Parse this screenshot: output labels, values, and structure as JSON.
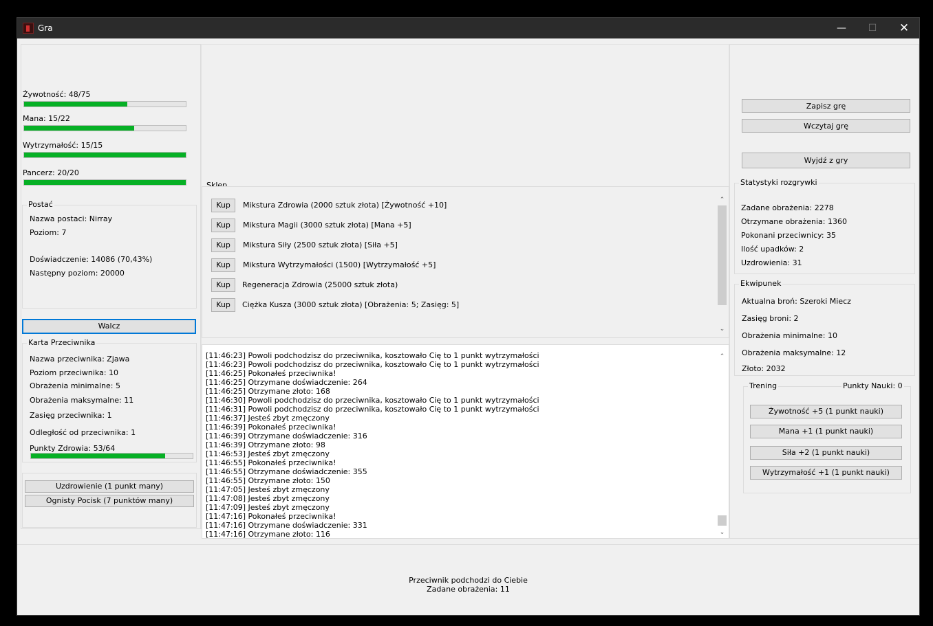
{
  "window": {
    "title": "Gra",
    "min": "—",
    "max": "☐",
    "close": "✕"
  },
  "stats": [
    {
      "label": "Żywotność: 48/75",
      "value": 48,
      "max": 75
    },
    {
      "label": "Mana: 15/22",
      "value": 15,
      "max": 22
    },
    {
      "label": "Wytrzymałość: 15/15",
      "value": 15,
      "max": 15
    },
    {
      "label": "Pancerz: 20/20",
      "value": 20,
      "max": 20
    }
  ],
  "postac": {
    "title": "Postać",
    "name": "Nazwa postaci: Nirray",
    "level": "Poziom: 7",
    "exp": "Doświadczenie: 14086 (70,43%)",
    "next": "Następny poziom: 20000"
  },
  "fight_button": "Walcz",
  "enemy": {
    "title": "Karta Przeciwnika",
    "name": "Nazwa przeciwnika: Zjawa",
    "level": "Poziom przeciwnika: 10",
    "dmg_min": "Obrażenia minimalne: 5",
    "dmg_max": "Obrażenia maksymalne: 11",
    "range": "Zasięg przeciwnika: 1",
    "distance": "Odległość od przeciwnika: 1",
    "hp_label": "Punkty Zdrowia: 53/64",
    "hp": 53,
    "hp_max": 64
  },
  "spells": [
    "Uzdrowienie (1 punkt many)",
    "Ognisty Pocisk (7 punktów many)"
  ],
  "shop": {
    "title": "Sklep",
    "buy_label": "Kup",
    "items": [
      "Mikstura Zdrowia (2000 sztuk złota) [Żywotność +10]",
      "Mikstura Magii (3000 sztuk złota) [Mana +5]",
      "Mikstura Siły (2500 sztuk złota) [Siła +5]",
      "Mikstura Wytrzymałości (1500) [Wytrzymałość +5]",
      "Regeneracja Zdrowia (25000 sztuk złota)",
      "Ciężka Kusza (3000 sztuk złota)  [Obrażenia: 5; Zasięg: 5]"
    ]
  },
  "log": [
    "[11:46:23] Powoli podchodzisz do przeciwnika, kosztowało Cię to 1 punkt wytrzymałości",
    "[11:46:23] Powoli podchodzisz do przeciwnika, kosztowało Cię to 1 punkt wytrzymałości",
    "[11:46:25] Pokonałeś przeciwnika!",
    "[11:46:25] Otrzymane doświadczenie: 264",
    "[11:46:25] Otrzymane złoto: 168",
    "[11:46:30] Powoli podchodzisz do przeciwnika, kosztowało Cię to 1 punkt wytrzymałości",
    "[11:46:31] Powoli podchodzisz do przeciwnika, kosztowało Cię to 1 punkt wytrzymałości",
    "[11:46:37] Jesteś zbyt zmęczony",
    "[11:46:39] Pokonałeś przeciwnika!",
    "[11:46:39] Otrzymane doświadczenie: 316",
    "[11:46:39] Otrzymane złoto: 98",
    "[11:46:53] Jesteś zbyt zmęczony",
    "[11:46:55] Pokonałeś przeciwnika!",
    "[11:46:55] Otrzymane doświadczenie: 355",
    "[11:46:55] Otrzymane złoto: 150",
    "[11:47:05] Jesteś zbyt zmęczony",
    "[11:47:08] Jesteś zbyt zmęczony",
    "[11:47:09] Jesteś zbyt zmęczony",
    "[11:47:16] Pokonałeś przeciwnika!",
    "[11:47:16] Otrzymane doświadczenie: 331",
    "[11:47:16] Otrzymane złoto: 116"
  ],
  "menu": {
    "save": "Zapisz grę",
    "load": "Wczytaj grę",
    "exit": "Wyjdź z gry"
  },
  "game_stats": {
    "title": "Statystyki rozgrywki",
    "dealt": "Zadane obrażenia: 2278",
    "received": "Otrzymane obrażenia: 1360",
    "defeated": "Pokonani przeciwnicy: 35",
    "falls": "Ilość upadków: 2",
    "heals": "Uzdrowienia: 31"
  },
  "equipment": {
    "title": "Ekwipunek",
    "weapon": "Aktualna broń: Szeroki Miecz",
    "range": "Zasięg broni: 2",
    "dmg_min": "Obrażenia minimalne: 10",
    "dmg_max": "Obrażenia maksymalne: 12",
    "gold": "Złoto: 2032"
  },
  "training": {
    "title": "Trening",
    "points": "Punkty Nauki: 0",
    "buttons": [
      "Żywotność +5 (1 punkt nauki)",
      "Mana +1 (1 punkt nauki)",
      "Siła +2 (1 punkt nauki)",
      "Wytrzymałość +1 (1 punkt nauki)"
    ]
  },
  "status": {
    "line1": "Przeciwnik podchodzi do Ciebie",
    "line2": "Zadane obrażenia: 11"
  },
  "colors": {
    "bar_fill": "#06b025",
    "focus": "#0078d7",
    "titlebar": "#2b2b2b"
  }
}
